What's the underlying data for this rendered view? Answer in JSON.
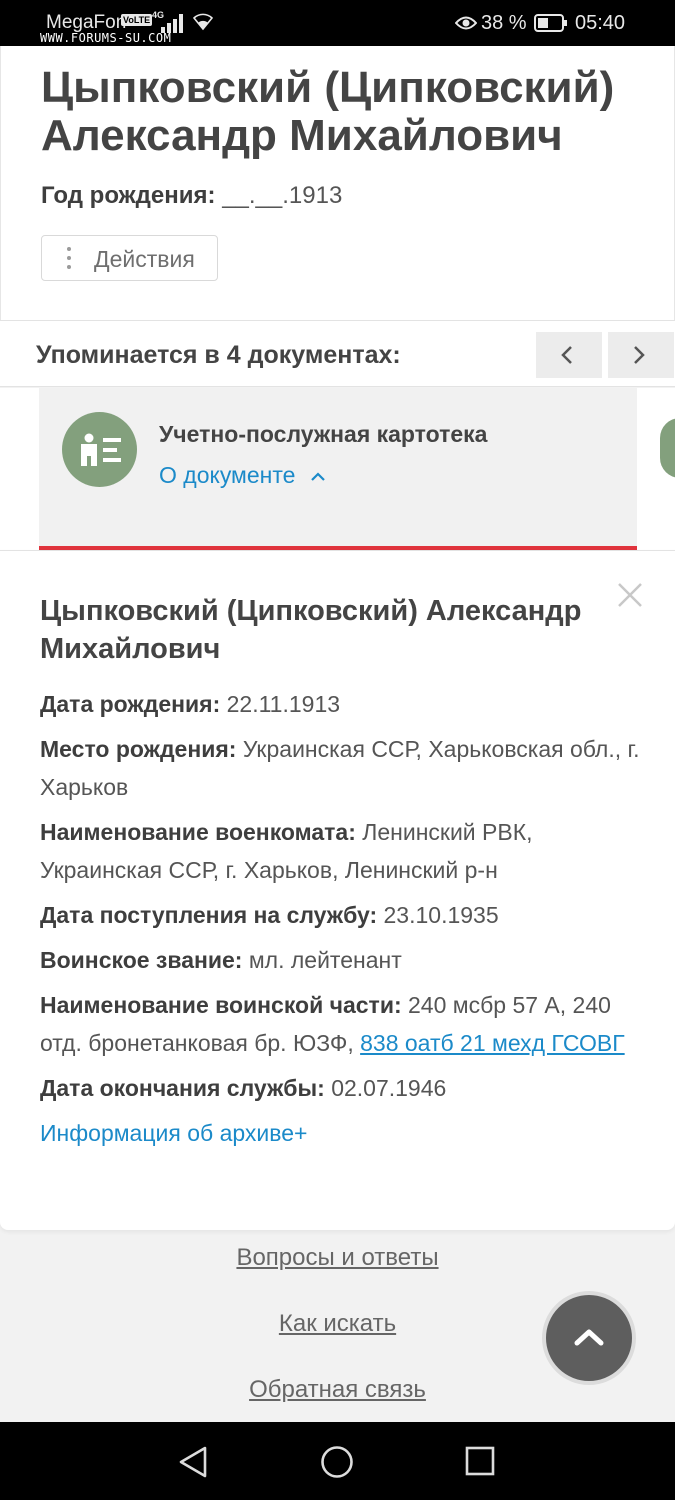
{
  "status_bar": {
    "carrier": "MegaFon",
    "volte": "VoLTE",
    "network": "4G",
    "watermark": "WWW.FORUMS-SU.COM",
    "battery": "38 %",
    "time": "05:40"
  },
  "person": {
    "name": "Цыпковский (Ципковский) Александр Михайлович",
    "birth_year_label": "Год рождения:",
    "birth_year_value": "__.__.1913",
    "actions_label": "Действия"
  },
  "mentions": {
    "label": "Упоминается в 4 документах:"
  },
  "document": {
    "type": "Учетно-послужная картотека",
    "about_label": "О документе"
  },
  "details": {
    "title": "Цыпковский (Ципковский) Александр Михайлович",
    "fields": [
      {
        "label": "Дата рождения:",
        "value": "22.11.1913"
      },
      {
        "label": "Место рождения:",
        "value": "Украинская ССР, Харьковская обл., г. Харьков"
      },
      {
        "label": "Наименование военкомата:",
        "value": "Ленинский РВК, Украинская ССР, г. Харьков, Ленинский р-н"
      },
      {
        "label": "Дата поступления на службу:",
        "value": "23.10.1935"
      },
      {
        "label": "Воинское звание:",
        "value": "мл. лейтенант"
      },
      {
        "label": "Наименование воинской части:",
        "value": "240 мсбр 57 А, 240 отд. бронетанковая бр. ЮЗФ,",
        "link": "838 оатб 21 мехд ГСОВГ"
      },
      {
        "label": "Дата окончания службы:",
        "value": "02.07.1946"
      }
    ],
    "archive_link": "Информация об архиве+"
  },
  "footer": {
    "faq": "Вопросы и ответы",
    "how_to_search": "Как искать",
    "feedback": "Обратная связь"
  },
  "colors": {
    "accent_link": "#1b8ac9",
    "doc_icon": "#83a07d",
    "red_line": "#e0333c"
  }
}
